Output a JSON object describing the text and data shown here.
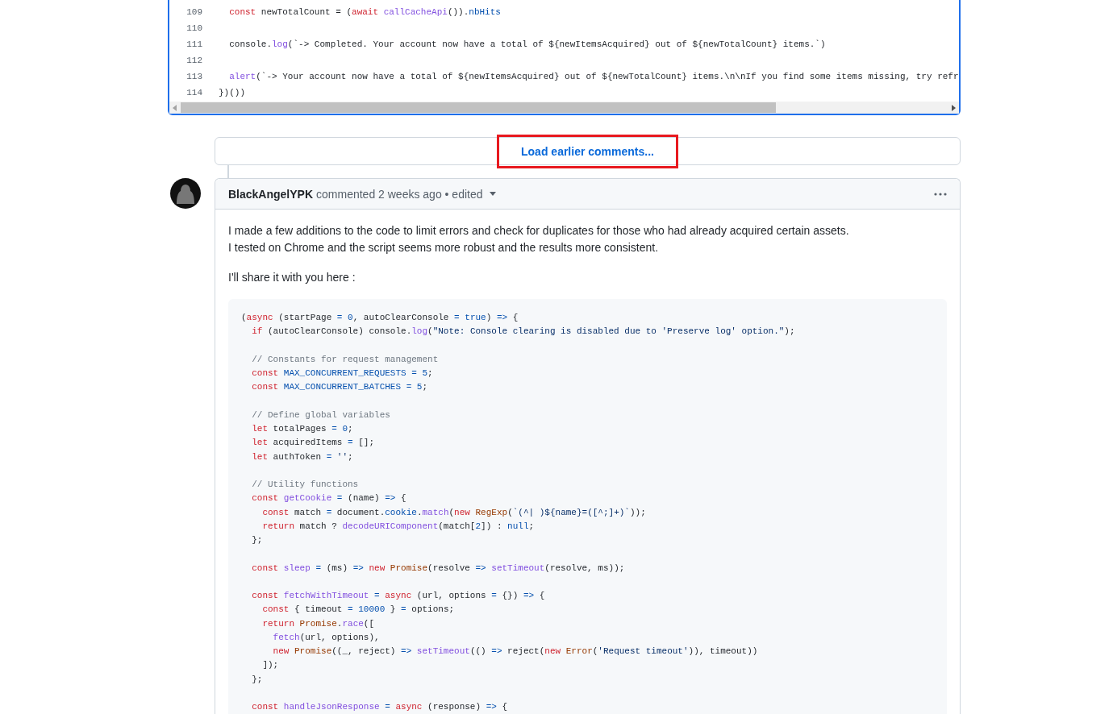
{
  "code_view": {
    "lines": [
      {
        "number": "109",
        "tokens": [
          {
            "kind": "kw",
            "text": "  const"
          },
          {
            "kind": "plain",
            "text": " newTotalCount = ("
          },
          {
            "kind": "kw",
            "text": "await"
          },
          {
            "kind": "fn",
            "text": " callCacheApi"
          },
          {
            "kind": "plain",
            "text": "())."
          },
          {
            "kind": "const",
            "text": "nbHits"
          }
        ]
      },
      {
        "number": "110"
      },
      {
        "number": "111",
        "tokens": [
          {
            "kind": "plain",
            "text": "  console."
          },
          {
            "kind": "fn",
            "text": "log"
          },
          {
            "kind": "plain",
            "text": "(`-> Completed. Your account now have a total of ${newItemsAcquired} out of ${newTotalCount} items.`)"
          }
        ]
      },
      {
        "number": "112"
      },
      {
        "number": "113",
        "tokens": [
          {
            "kind": "fn",
            "text": "  alert"
          },
          {
            "kind": "plain",
            "text": "(`-> Your account now have a total of ${newItemsAcquired} out of ${newTotalCount} items.\\n\\nIf you find some items missing, try refr"
          }
        ]
      },
      {
        "number": "114",
        "tokens": [
          {
            "kind": "plain",
            "text": "})())"
          }
        ]
      }
    ]
  },
  "load_more": {
    "label": "Load earlier comments..."
  },
  "comment": {
    "author": "BlackAngelYPK",
    "meta": "commented 2 weeks ago • edited",
    "paragraphs": [
      [
        "I made a few additions to the code to limit errors and check for duplicates for those who had already acquired certain assets.",
        "I tested on Chrome and the script seems more robust and the results more consistent."
      ],
      [
        "I'll share it with you here :"
      ]
    ],
    "code": [
      {
        "spaced": false,
        "tokens": [
          {
            "kind": "plain",
            "text": "("
          },
          {
            "kind": "kw",
            "text": "async"
          },
          {
            "kind": "plain",
            "text": " (startPage "
          },
          {
            "kind": "const",
            "text": "= 0"
          },
          {
            "kind": "plain",
            "text": ", autoClearConsole "
          },
          {
            "kind": "const",
            "text": "= true"
          },
          {
            "kind": "plain",
            "text": ") "
          },
          {
            "kind": "const",
            "text": "=>"
          },
          {
            "kind": "plain",
            "text": " {"
          }
        ]
      },
      {
        "spaced": false,
        "tokens": [
          {
            "kind": "kw",
            "text": "  if"
          },
          {
            "kind": "plain",
            "text": " (autoClearConsole) console."
          },
          {
            "kind": "fn",
            "text": "log"
          },
          {
            "kind": "plain",
            "text": "("
          },
          {
            "kind": "str",
            "text": "\"Note: Console clearing is disabled due to 'Preserve log' option.\""
          },
          {
            "kind": "plain",
            "text": ");"
          }
        ]
      },
      {
        "spaced": true,
        "tokens": [
          {
            "kind": "comment",
            "text": "  // Constants for request management"
          }
        ]
      },
      {
        "spaced": false,
        "tokens": [
          {
            "kind": "kw",
            "text": "  const"
          },
          {
            "kind": "const",
            "text": " MAX_CONCURRENT_REQUESTS = 5"
          },
          {
            "kind": "plain",
            "text": ";"
          }
        ]
      },
      {
        "spaced": false,
        "tokens": [
          {
            "kind": "kw",
            "text": "  const"
          },
          {
            "kind": "const",
            "text": " MAX_CONCURRENT_BATCHES = 5"
          },
          {
            "kind": "plain",
            "text": ";"
          }
        ]
      },
      {
        "spaced": true,
        "tokens": [
          {
            "kind": "comment",
            "text": "  // Define global variables"
          }
        ]
      },
      {
        "spaced": false,
        "tokens": [
          {
            "kind": "kw",
            "text": "  let"
          },
          {
            "kind": "plain",
            "text": " totalPages "
          },
          {
            "kind": "const",
            "text": "= 0"
          },
          {
            "kind": "plain",
            "text": ";"
          }
        ]
      },
      {
        "spaced": false,
        "tokens": [
          {
            "kind": "kw",
            "text": "  let"
          },
          {
            "kind": "plain",
            "text": " acquiredItems "
          },
          {
            "kind": "const",
            "text": "="
          },
          {
            "kind": "plain",
            "text": " [];"
          }
        ]
      },
      {
        "spaced": false,
        "tokens": [
          {
            "kind": "kw",
            "text": "  let"
          },
          {
            "kind": "plain",
            "text": " authToken "
          },
          {
            "kind": "const",
            "text": "="
          },
          {
            "kind": "str",
            "text": " ''"
          },
          {
            "kind": "plain",
            "text": ";"
          }
        ]
      },
      {
        "spaced": true,
        "tokens": [
          {
            "kind": "comment",
            "text": "  // Utility functions"
          }
        ]
      },
      {
        "spaced": false,
        "tokens": [
          {
            "kind": "kw",
            "text": "  const"
          },
          {
            "kind": "fn",
            "text": " getCookie"
          },
          {
            "kind": "const",
            "text": " ="
          },
          {
            "kind": "plain",
            "text": " (name) "
          },
          {
            "kind": "const",
            "text": "=>"
          },
          {
            "kind": "plain",
            "text": " {"
          }
        ]
      },
      {
        "spaced": false,
        "tokens": [
          {
            "kind": "kw",
            "text": "    const"
          },
          {
            "kind": "plain",
            "text": " match "
          },
          {
            "kind": "const",
            "text": "="
          },
          {
            "kind": "plain",
            "text": " document."
          },
          {
            "kind": "const",
            "text": "cookie"
          },
          {
            "kind": "plain",
            "text": "."
          },
          {
            "kind": "fn",
            "text": "match"
          },
          {
            "kind": "plain",
            "text": "("
          },
          {
            "kind": "kw",
            "text": "new"
          },
          {
            "kind": "type",
            "text": " RegExp"
          },
          {
            "kind": "plain",
            "text": "("
          },
          {
            "kind": "str",
            "text": "`(^| )${name}=([^;]+)`"
          },
          {
            "kind": "plain",
            "text": "));"
          }
        ]
      },
      {
        "spaced": false,
        "tokens": [
          {
            "kind": "kw",
            "text": "    return"
          },
          {
            "kind": "plain",
            "text": " match ? "
          },
          {
            "kind": "fn",
            "text": "decodeURIComponent"
          },
          {
            "kind": "plain",
            "text": "(match["
          },
          {
            "kind": "const",
            "text": "2"
          },
          {
            "kind": "plain",
            "text": "]) : "
          },
          {
            "kind": "const",
            "text": "null"
          },
          {
            "kind": "plain",
            "text": ";"
          }
        ]
      },
      {
        "spaced": false,
        "tokens": [
          {
            "kind": "plain",
            "text": "  };"
          }
        ]
      },
      {
        "spaced": true,
        "tokens": [
          {
            "kind": "kw",
            "text": "  const"
          },
          {
            "kind": "fn",
            "text": " sleep"
          },
          {
            "kind": "const",
            "text": " ="
          },
          {
            "kind": "plain",
            "text": " (ms) "
          },
          {
            "kind": "const",
            "text": "=>"
          },
          {
            "kind": "kw",
            "text": " new"
          },
          {
            "kind": "type",
            "text": " Promise"
          },
          {
            "kind": "plain",
            "text": "(resolve "
          },
          {
            "kind": "const",
            "text": "=>"
          },
          {
            "kind": "fn",
            "text": " setTimeout"
          },
          {
            "kind": "plain",
            "text": "(resolve, ms));"
          }
        ]
      },
      {
        "spaced": true,
        "tokens": [
          {
            "kind": "kw",
            "text": "  const"
          },
          {
            "kind": "fn",
            "text": " fetchWithTimeout"
          },
          {
            "kind": "const",
            "text": " ="
          },
          {
            "kind": "kw",
            "text": " async"
          },
          {
            "kind": "plain",
            "text": " (url, options "
          },
          {
            "kind": "const",
            "text": "="
          },
          {
            "kind": "plain",
            "text": " {}) "
          },
          {
            "kind": "const",
            "text": "=>"
          },
          {
            "kind": "plain",
            "text": " {"
          }
        ]
      },
      {
        "spaced": false,
        "tokens": [
          {
            "kind": "kw",
            "text": "    const"
          },
          {
            "kind": "plain",
            "text": " { timeout "
          },
          {
            "kind": "const",
            "text": "= 10000"
          },
          {
            "kind": "plain",
            "text": " } "
          },
          {
            "kind": "const",
            "text": "="
          },
          {
            "kind": "plain",
            "text": " options;"
          }
        ]
      },
      {
        "spaced": false,
        "tokens": [
          {
            "kind": "kw",
            "text": "    return"
          },
          {
            "kind": "type",
            "text": " Promise"
          },
          {
            "kind": "plain",
            "text": "."
          },
          {
            "kind": "fn",
            "text": "race"
          },
          {
            "kind": "plain",
            "text": "(["
          }
        ]
      },
      {
        "spaced": false,
        "tokens": [
          {
            "kind": "fn",
            "text": "      fetch"
          },
          {
            "kind": "plain",
            "text": "(url, options),"
          }
        ]
      },
      {
        "spaced": false,
        "tokens": [
          {
            "kind": "kw",
            "text": "      new"
          },
          {
            "kind": "type",
            "text": " Promise"
          },
          {
            "kind": "plain",
            "text": "((_, reject) "
          },
          {
            "kind": "const",
            "text": "=>"
          },
          {
            "kind": "fn",
            "text": " setTimeout"
          },
          {
            "kind": "plain",
            "text": "(() "
          },
          {
            "kind": "const",
            "text": "=>"
          },
          {
            "kind": "plain",
            "text": " reject("
          },
          {
            "kind": "kw",
            "text": "new"
          },
          {
            "kind": "type",
            "text": " Error"
          },
          {
            "kind": "plain",
            "text": "("
          },
          {
            "kind": "str",
            "text": "'Request timeout'"
          },
          {
            "kind": "plain",
            "text": ")), timeout))"
          }
        ]
      },
      {
        "spaced": false,
        "tokens": [
          {
            "kind": "plain",
            "text": "    ]);"
          }
        ]
      },
      {
        "spaced": false,
        "tokens": [
          {
            "kind": "plain",
            "text": "  };"
          }
        ]
      },
      {
        "spaced": true,
        "tokens": [
          {
            "kind": "kw",
            "text": "  const"
          },
          {
            "kind": "fn",
            "text": " handleJsonResponse"
          },
          {
            "kind": "const",
            "text": " ="
          },
          {
            "kind": "kw",
            "text": " async"
          },
          {
            "kind": "plain",
            "text": " (response) "
          },
          {
            "kind": "const",
            "text": "=>"
          },
          {
            "kind": "plain",
            "text": " {"
          }
        ]
      }
    ]
  }
}
